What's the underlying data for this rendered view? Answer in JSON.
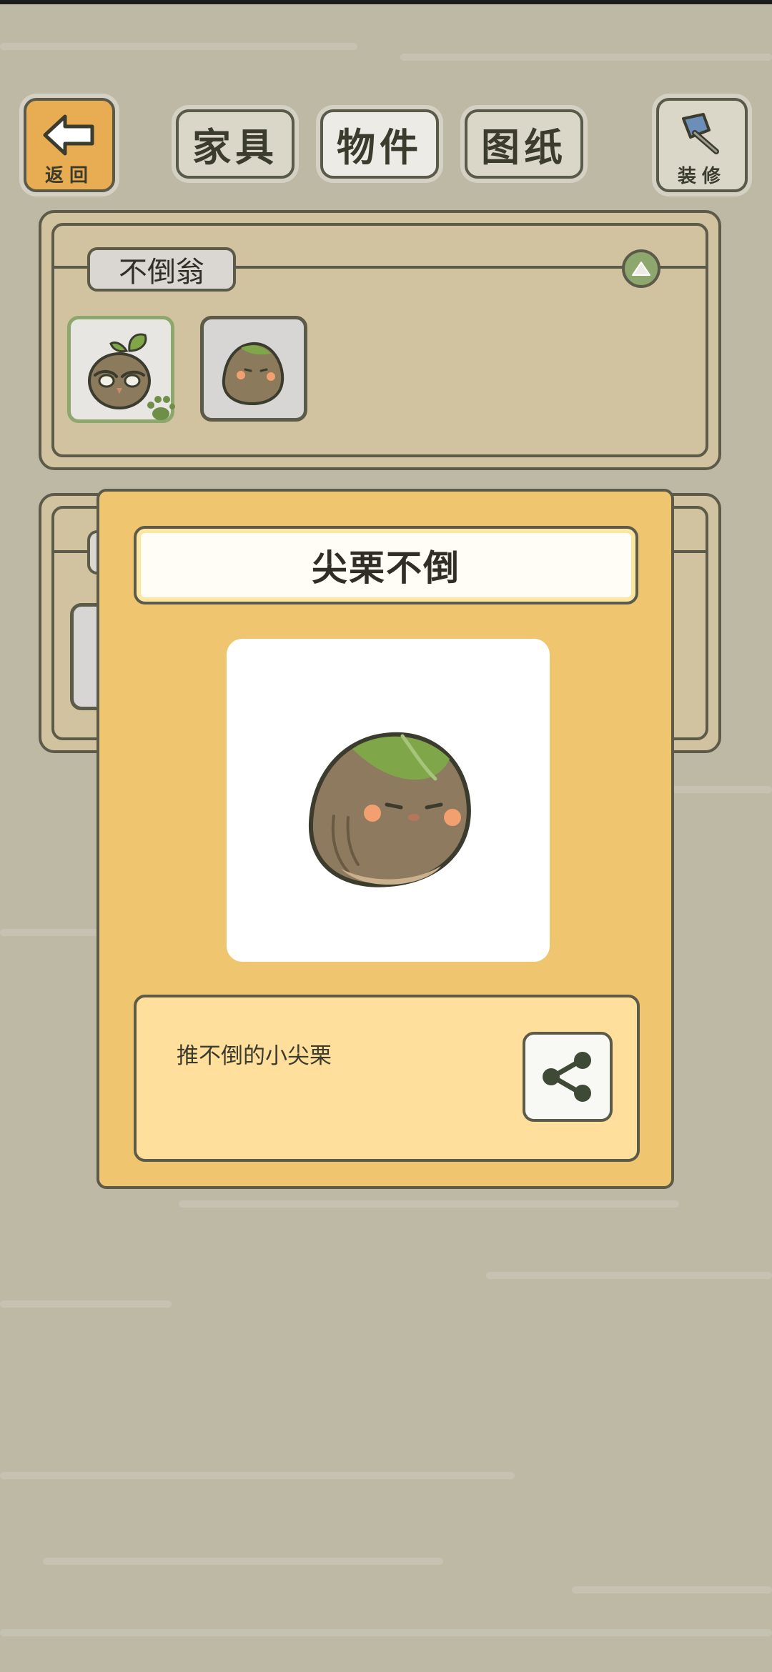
{
  "top_bar": {
    "back_label": "返回",
    "tabs": [
      {
        "label": "家具",
        "active": false
      },
      {
        "label": "物件",
        "active": true
      },
      {
        "label": "图纸",
        "active": false
      }
    ],
    "decorate_label": "装修"
  },
  "panels": [
    {
      "title": "不倒翁",
      "expanded": true,
      "items": [
        {
          "icon": "owl-sprout-tumbler-icon",
          "selected": true
        },
        {
          "icon": "chestnut-tumbler-icon",
          "selected": false
        }
      ]
    },
    {
      "title": "",
      "expanded": true
    }
  ],
  "detail": {
    "title": "尖栗不倒",
    "description": "推不倒的小尖栗",
    "preview_icon": "chestnut-tumbler-icon",
    "share_icon": "share-icon"
  },
  "colors": {
    "background": "#bdb9a5",
    "panel": "#d2c3a0",
    "card": "#efc570",
    "description_box": "#ffdf9b",
    "outline": "#5c5a48",
    "accent_green": "#8da76d"
  }
}
